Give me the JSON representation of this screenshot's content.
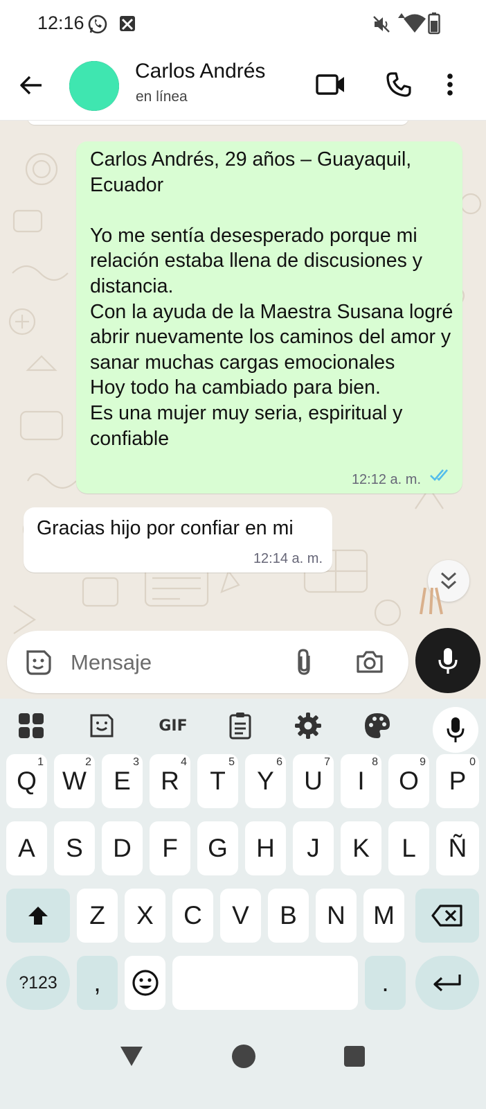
{
  "status_bar": {
    "time": "12:16",
    "icons": [
      "whatsapp-icon",
      "app-notification-icon",
      "mute-icon",
      "data-arrows-icon",
      "wifi-icon",
      "battery-icon"
    ]
  },
  "header": {
    "contact_name": "Carlos Andrés",
    "contact_status": "en línea",
    "icons": [
      "back-arrow-icon",
      "video-call-icon",
      "phone-icon",
      "more-vert-icon"
    ]
  },
  "messages": [
    {
      "direction": "outgoing",
      "text": "Carlos Andrés, 29 años – Guayaquil, Ecuador\n\nYo me sentía desesperado porque mi relación estaba llena de discusiones y distancia.\nCon la ayuda de la Maestra Susana logré abrir nuevamente los caminos del amor y sanar muchas cargas emocionales\nHoy todo ha cambiado para bien.\nEs una mujer muy seria, espiritual y confiable",
      "time": "12:12 a. m.",
      "status": "read"
    },
    {
      "direction": "incoming",
      "text": "Gracias hijo por confiar en mi",
      "time": "12:14 a. m."
    }
  ],
  "composer": {
    "placeholder": "Mensaje",
    "icons": [
      "sticker-icon",
      "attach-icon",
      "camera-icon",
      "mic-icon"
    ]
  },
  "keyboard": {
    "toolbar": [
      "apps-grid-icon",
      "sticker-icon",
      "gif-icon",
      "clipboard-icon",
      "settings-gear-icon",
      "palette-icon",
      "mic-icon"
    ],
    "gif_label": "GIF",
    "row1": [
      "Q",
      "W",
      "E",
      "R",
      "T",
      "Y",
      "U",
      "I",
      "O",
      "P"
    ],
    "row1_hints": [
      "1",
      "2",
      "3",
      "4",
      "5",
      "6",
      "7",
      "8",
      "9",
      "0"
    ],
    "row2": [
      "A",
      "S",
      "D",
      "F",
      "G",
      "H",
      "J",
      "K",
      "L",
      "Ñ"
    ],
    "row3": [
      "Z",
      "X",
      "C",
      "V",
      "B",
      "N",
      "M"
    ],
    "symbols_key": "?123",
    "comma_key": ",",
    "period_key": ".",
    "special_icons": [
      "shift-icon",
      "backspace-icon",
      "emoji-icon",
      "enter-icon"
    ]
  },
  "nav_bar": {
    "icons": [
      "back-triangle-icon",
      "home-circle-icon",
      "recents-square-icon"
    ]
  },
  "colors": {
    "outgoing_bubble": "#d9fdd3",
    "incoming_bubble": "#ffffff",
    "chat_background": "#efeae2",
    "read_ticks": "#53bdeb",
    "keyboard_background": "#e8eeee",
    "special_key": "#d2e6e6",
    "mic_button": "#1c1c1c"
  }
}
